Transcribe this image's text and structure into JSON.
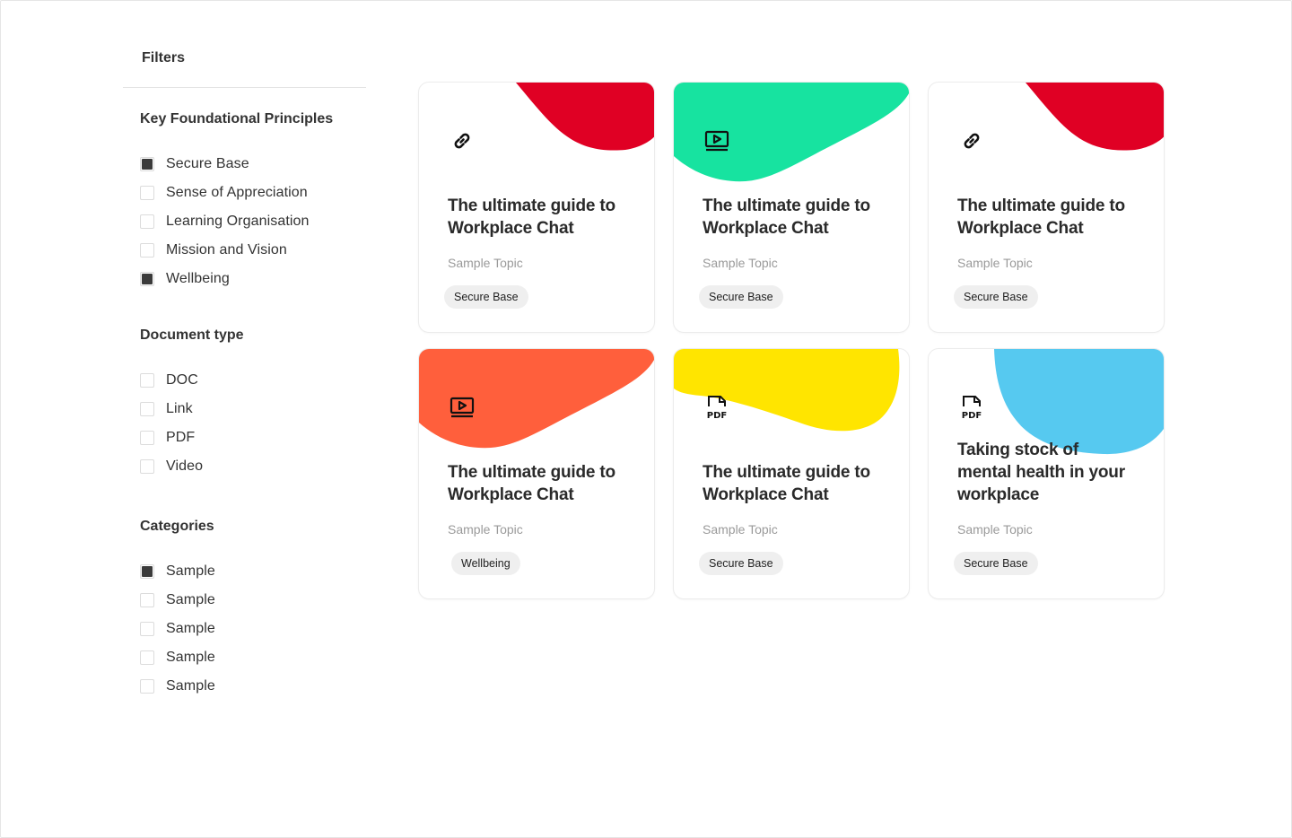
{
  "sidebar": {
    "title": "Filters",
    "groups": [
      {
        "title": "Key Foundational Principles",
        "options": [
          {
            "label": "Secure Base",
            "checked": true
          },
          {
            "label": "Sense of Appreciation",
            "checked": false
          },
          {
            "label": "Learning Organisation",
            "checked": false
          },
          {
            "label": "Mission and Vision",
            "checked": false
          },
          {
            "label": "Wellbeing",
            "checked": true
          }
        ]
      },
      {
        "title": "Document type",
        "options": [
          {
            "label": "DOC",
            "checked": false
          },
          {
            "label": "Link",
            "checked": false
          },
          {
            "label": "PDF",
            "checked": false
          },
          {
            "label": "Video",
            "checked": false
          }
        ]
      },
      {
        "title": "Categories",
        "options": [
          {
            "label": "Sample",
            "checked": true
          },
          {
            "label": "Sample",
            "checked": false
          },
          {
            "label": "Sample",
            "checked": false
          },
          {
            "label": "Sample",
            "checked": false
          },
          {
            "label": "Sample",
            "checked": false
          }
        ]
      }
    ]
  },
  "cards": [
    {
      "icon": "link-icon",
      "accent": "#e00024",
      "title_line1": "The ultimate guide to",
      "title_line2": "Workplace Chat",
      "title_line3": "",
      "topic": "Sample Topic",
      "tag": "Secure Base"
    },
    {
      "icon": "video-icon",
      "accent": "#17e3a0",
      "title_line1": "The ultimate guide to",
      "title_line2": "Workplace Chat",
      "title_line3": "",
      "topic": "Sample Topic",
      "tag": "Secure Base"
    },
    {
      "icon": "link-icon",
      "accent": "#e00024",
      "title_line1": "The ultimate guide to",
      "title_line2": "Workplace Chat",
      "title_line3": "",
      "topic": "Sample Topic",
      "tag": "Secure Base"
    },
    {
      "icon": "video-icon",
      "accent": "#ff5f3c",
      "title_line1": "The ultimate guide to",
      "title_line2": "Workplace Chat",
      "title_line3": "",
      "topic": "Sample Topic",
      "tag": "Wellbeing"
    },
    {
      "icon": "pdf-icon",
      "accent": "#ffe500",
      "title_line1": "The ultimate guide to",
      "title_line2": "Workplace Chat",
      "title_line3": "",
      "topic": "Sample Topic",
      "tag": "Secure Base"
    },
    {
      "icon": "pdf-icon",
      "accent": "#56c9f0",
      "title_line1": "Taking stock of",
      "title_line2": "mental health in your",
      "title_line3": "workplace",
      "topic": "Sample Topic",
      "tag": "Secure Base"
    }
  ]
}
